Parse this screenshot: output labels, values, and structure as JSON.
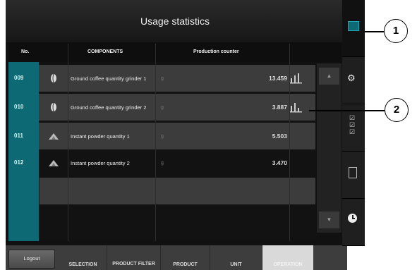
{
  "title": "Usage statistics",
  "headers": {
    "no": "No.",
    "components": "COMPONENTS",
    "counter": "Production counter"
  },
  "rows": [
    {
      "no": "009",
      "icon": "coffee-bean-icon",
      "name": "Ground coffee quantity grinder 1",
      "unit": "g",
      "value": "13.459",
      "chart": true
    },
    {
      "no": "010",
      "icon": "coffee-bean-icon",
      "name": "Ground coffee quantity grinder 2",
      "unit": "g",
      "value": "3.887",
      "chart": true
    },
    {
      "no": "011",
      "icon": "powder-icon",
      "name": "Instant powder quantity 1",
      "unit": "g",
      "value": "5.503",
      "chart": false
    },
    {
      "no": "012",
      "icon": "powder-icon",
      "name": "Instant powder quantity 2",
      "unit": "g",
      "value": "3.470",
      "chart": false
    }
  ],
  "bottom_nav": {
    "logout": "Logout",
    "items": [
      "SELECTION",
      "PRODUCT FILTER",
      "PRODUCT",
      "UNIT",
      "OPERATION"
    ]
  },
  "callouts": [
    "1",
    "2"
  ],
  "colors": {
    "accent": "#0d6a75",
    "active_tab": "#d9d9d9"
  }
}
